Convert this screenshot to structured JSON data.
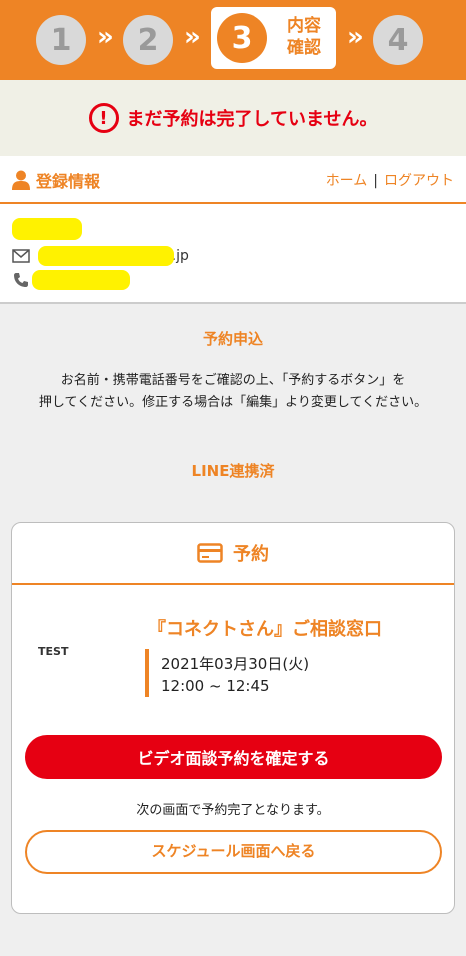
{
  "steps": {
    "items": [
      "1",
      "2",
      "3",
      "4"
    ],
    "arrow": "»",
    "active_number": "3",
    "active_label_line1": "内容",
    "active_label_line2": "確認"
  },
  "warning": {
    "icon": "exclamation-circle-icon",
    "text": "まだ予約は完了していません。"
  },
  "registration": {
    "title": "登録情報",
    "link_home": "ホーム",
    "separator": "|",
    "link_logout": "ログアウト",
    "email_partial": "@p-tabo.co.jp"
  },
  "reservation_request": {
    "title": "予約申込",
    "instructions_line1": "お名前・携帯電話番号をご確認の上、「予約するボタン」を",
    "instructions_line2": "押してください。修正する場合は「編集」より変更してください。"
  },
  "line_status": "LINE連携済",
  "card": {
    "title": "予約",
    "test_label": "TEST",
    "slot_title": "『コネクトさん』ご相談窓口",
    "date": "2021年03月30日(火)",
    "time": "12:00 ~ 12:45",
    "confirm_button": "ビデオ面談予約を確定する",
    "note": "次の画面で予約完了となります。",
    "back_button": "スケジュール画面へ戻る"
  },
  "colors": {
    "brand": "#ee8425",
    "danger": "#e60012",
    "mask": "#fff200"
  }
}
